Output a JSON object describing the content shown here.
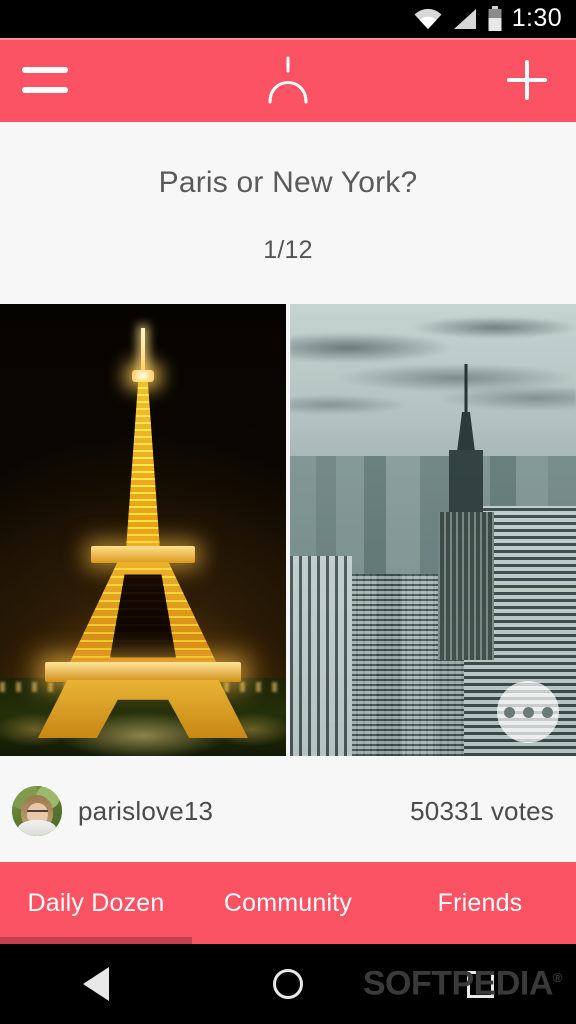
{
  "status_bar": {
    "time": "1:30",
    "icons": [
      "wifi-icon",
      "cellular-signal-icon",
      "battery-icon"
    ]
  },
  "app_bar": {
    "menu_icon": "hamburger-menu-icon",
    "logo_icon": "wishbone-logo-icon",
    "add_icon": "plus-icon",
    "background_color": "#fb5364"
  },
  "poll": {
    "question": "Paris or New York?",
    "counter": "1/12",
    "left_choice": {
      "name": "Paris",
      "description": "Eiffel Tower illuminated at night"
    },
    "right_choice": {
      "name": "New York",
      "description": "New York City skyline with Empire State Building"
    },
    "more_button_icon": "more-options-icon"
  },
  "meta": {
    "avatar": "user-avatar",
    "username": "parislove13",
    "votes": "50331 votes"
  },
  "tabs": [
    {
      "label": "Daily Dozen",
      "active": true
    },
    {
      "label": "Community",
      "active": false
    },
    {
      "label": "Friends",
      "active": false
    }
  ],
  "nav_bar": {
    "back_icon": "back-triangle-icon",
    "home_icon": "home-circle-icon",
    "recents_icon": "recents-square-icon",
    "watermark": "SOFTPEDIA"
  },
  "colors": {
    "accent": "#fb5364",
    "tab_indicator": "#c3404f",
    "background": "#f7f7f7",
    "text": "#4b4b4b"
  }
}
